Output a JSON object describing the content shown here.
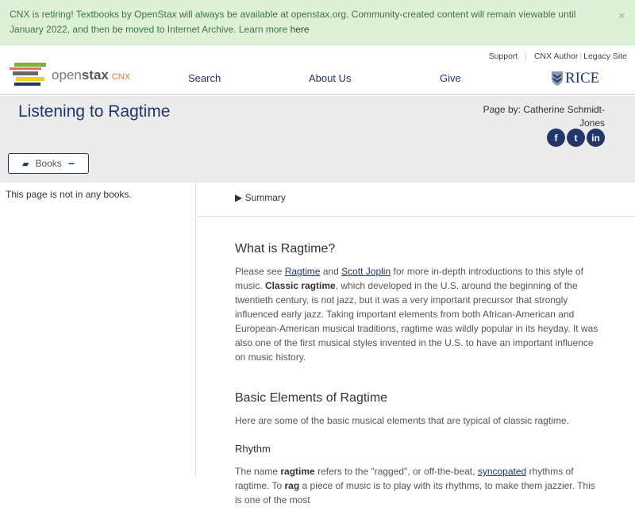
{
  "banner": {
    "text": "CNX is retiring! Textbooks by OpenStax will always be available at openstax.org. Community-created content will remain viewable until January 2022, and then be moved to Internet Archive. Learn more ",
    "link": "here",
    "close": "×"
  },
  "header": {
    "util": [
      "Support",
      "CNX Author",
      "Legacy Site"
    ],
    "logo": {
      "open": "open",
      "stax": "stax",
      "cnx": "CNX"
    },
    "nav": [
      "Search",
      "About Us",
      "Give"
    ],
    "rice": "RICE"
  },
  "page": {
    "title": "Listening to Ragtime",
    "page_by": "Page by: Catherine Schmidt-Jones",
    "social": [
      "f",
      "t",
      "in"
    ],
    "books_label": "Books",
    "books_toggle": "−"
  },
  "sidebar": {
    "text": "This page is not in any books."
  },
  "summary": {
    "label": "▶  Summary"
  },
  "content": {
    "h1": "What is Ragtime?",
    "p1": [
      {
        "t": "Please see "
      },
      {
        "t": "Ragtime",
        "link": true
      },
      {
        "t": " and "
      },
      {
        "t": "Scott Joplin",
        "link": true
      },
      {
        "t": " for more in-depth introductions to this style of music. "
      },
      {
        "t": "Classic ragtime",
        "bold": true
      },
      {
        "t": ", which developed in the U.S. around the beginning of the twentieth century, is not jazz, but it was a very important precursor that strongly influenced early jazz. Taking important elements from both African-American and European-American musical traditions, ragtime was wildly popular in its heyday. It was also one of the first musical styles invented in the U.S. to have an important influence on music history."
      }
    ],
    "h2": "Basic Elements of Ragtime",
    "p2": [
      {
        "t": "Here are some of the basic musical elements that are typical of classic ragtime."
      }
    ],
    "h3": "Rhythm",
    "p3": [
      {
        "t": "The name "
      },
      {
        "t": "ragtime",
        "bold": true
      },
      {
        "t": " refers to the \"ragged\", or off-the-beat, "
      },
      {
        "t": "syncopated",
        "link": true
      },
      {
        "t": " rhythms of ragtime. To "
      },
      {
        "t": "rag",
        "bold": true
      },
      {
        "t": " a piece of music is to play with its rhythms, to make them jazzier. This is one of the most"
      }
    ]
  }
}
